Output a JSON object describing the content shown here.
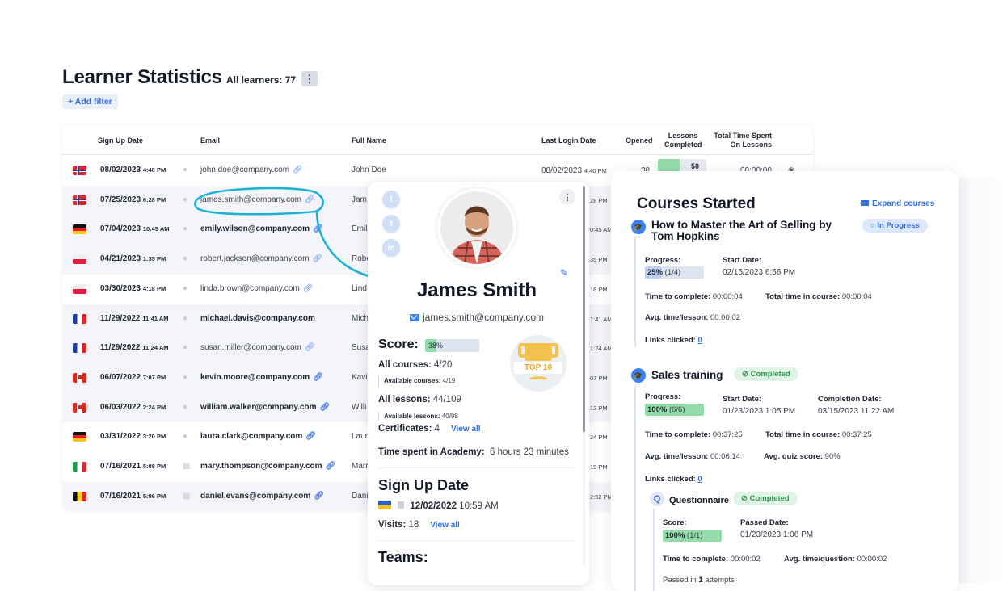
{
  "header": {
    "title": "Learner Statistics",
    "learner_count": "All learners: 77",
    "menu_icon": "kebab-menu-icon",
    "add_filter": "+ Add filter"
  },
  "table": {
    "columns": [
      "Sign Up Date",
      "Email",
      "Full Name",
      "Last Login Date",
      "Opened",
      "Lessons Completed",
      "Total Time Spent On Lessons"
    ],
    "rows": [
      {
        "country": "norway",
        "date": "08/02/2023",
        "time": "4:40 PM",
        "os": "apple",
        "email": "john.doe@company.com",
        "email_bold": false,
        "link": true,
        "name": "John Doe",
        "login_date": "08/02/2023",
        "login_time": "4:40 PM",
        "opened": "38",
        "lessons": "50",
        "lessons_fraction": 0.45,
        "time_spent": "00:00:00"
      },
      {
        "country": "norway",
        "date": "07/25/2023",
        "time": "6:28 PM",
        "os": "apple",
        "email": "james.smith@company.com",
        "email_bold": false,
        "link": true,
        "name": "Jam",
        "login_tail": "28 PM"
      },
      {
        "country": "germany",
        "date": "07/04/2023",
        "time": "10:45 AM",
        "os": "apple",
        "email": "emily.wilson@company.com",
        "email_bold": true,
        "link": true,
        "name": "Emil",
        "login_tail": "0:45 AM"
      },
      {
        "country": "poland",
        "date": "04/21/2023",
        "time": "1:35 PM",
        "os": "apple",
        "email": "robert.jackson@company.com",
        "email_bold": false,
        "link": true,
        "name": "Robe",
        "login_tail": "35 PM"
      },
      {
        "country": "poland",
        "date": "03/30/2023",
        "time": "4:18 PM",
        "os": "apple",
        "email": "linda.brown@company.com",
        "email_bold": false,
        "link": true,
        "name": "Lind",
        "login_tail": "18 PM"
      },
      {
        "country": "france",
        "date": "11/29/2022",
        "time": "11:41 AM",
        "os": "apple",
        "email": "michael.davis@company.com",
        "email_bold": true,
        "link": false,
        "name": "Mich",
        "login_tail": "1:41 AM"
      },
      {
        "country": "france",
        "date": "11/29/2022",
        "time": "11:24 AM",
        "os": "apple",
        "email": "susan.miller@company.com",
        "email_bold": false,
        "link": true,
        "name": "Susa",
        "login_tail": "1:24 AM"
      },
      {
        "country": "canada",
        "date": "06/07/2022",
        "time": "7:07 PM",
        "os": "apple",
        "email": "kevin.moore@company.com",
        "email_bold": true,
        "link": true,
        "name": "Kavi",
        "login_tail": "07 PM"
      },
      {
        "country": "canada",
        "date": "06/03/2022",
        "time": "2:24 PM",
        "os": "apple",
        "email": "william.walker@company.com",
        "email_bold": true,
        "link": true,
        "name": "Willi",
        "login_tail": "13 PM"
      },
      {
        "country": "germany",
        "date": "03/31/2022",
        "time": "3:20 PM",
        "os": "apple",
        "email": "laura.clark@company.com",
        "email_bold": true,
        "link": true,
        "name": "Laur",
        "login_tail": "24 PM"
      },
      {
        "country": "italy",
        "date": "07/16/2021",
        "time": "5:08 PM",
        "os": "windows",
        "email": "mary.thompson@company.com",
        "email_bold": true,
        "link": true,
        "name": "Marr",
        "login_tail": "19 PM"
      },
      {
        "country": "belgium",
        "date": "07/16/2021",
        "time": "5:06 PM",
        "os": "windows",
        "email": "daniel.evans@company.com",
        "email_bold": true,
        "link": true,
        "name": "Dani",
        "login_tail": "2:52 PM"
      }
    ]
  },
  "profile": {
    "social": [
      "f",
      "t",
      "in"
    ],
    "name": "James Smith",
    "email": "james.smith@company.com",
    "score_label": "Score:",
    "score": "38%",
    "score_fraction": 0.38,
    "all_courses_label": "All courses:",
    "all_courses": "4/20",
    "available_courses_label": "Available courses:",
    "available_courses": "4/19",
    "all_lessons_label": "All lessons:",
    "all_lessons": "44/109",
    "available_lessons_label": "Available lessons:",
    "available_lessons": "40/98",
    "certificates_label": "Certificates:",
    "certificates": "4",
    "view_all": "View all",
    "time_label": "Time spent in Academy:",
    "time_value": "6 hours 23 minutes",
    "badge": "TOP 10",
    "signup_heading": "Sign Up Date",
    "signup_date": "12/02/2022",
    "signup_time": "10:59 AM",
    "visits_label": "Visits:",
    "visits": "18",
    "visits_view_all": "View all",
    "teams_heading": "Teams:"
  },
  "courses": {
    "title": "Courses Started",
    "expand": "Expand courses",
    "items": [
      {
        "title_line1": "How to Master the Art of Selling by",
        "title_line2": "Tom Hopkins",
        "status": "In Progress",
        "progress_label": "Progress:",
        "progress_pct": "25%",
        "progress_count": "(1/4)",
        "progress_fraction": 0.25,
        "start_label": "Start Date:",
        "start": "02/15/2023 6:56 PM",
        "ttc_label": "Time to complete:",
        "ttc": "00:00:04",
        "total_label": "Total time in course:",
        "total": "00:00:04",
        "avg_label": "Avg. time/lesson:",
        "avg": "00:00:02",
        "links_label": "Links clicked:",
        "links": "0"
      },
      {
        "title": "Sales training",
        "status": "Completed",
        "progress_label": "Progress:",
        "progress_pct": "100%",
        "progress_count": "(6/6)",
        "progress_fraction": 1.0,
        "start_label": "Start Date:",
        "start": "01/23/2023 1:05 PM",
        "completion_label": "Completion Date:",
        "completion": "03/15/2023 11:22 AM",
        "ttc_label": "Time to complete:",
        "ttc": "00:37:25",
        "total_label": "Total time in course:",
        "total": "00:37:25",
        "avg_label": "Avg. time/lesson:",
        "avg": "00:06:14",
        "quiz_label": "Avg. quiz score:",
        "quiz": "90%",
        "links_label": "Links clicked:",
        "links": "0",
        "quiz_item": {
          "icon": "Q",
          "title": "Questionnaire",
          "status": "Completed",
          "score_label": "Score:",
          "score_pct": "100%",
          "score_count": "(1/1)",
          "score_fraction": 1.0,
          "passed_label": "Passed Date:",
          "passed": "01/23/2023 1:06 PM",
          "ttc_label": "Time to complete:",
          "ttc": "00:00:02",
          "avgq_label": "Avg. time/question:",
          "avgq": "00:00:02",
          "attempts_prefix": "Passed in",
          "attempts": "1",
          "attempts_suffix": "attempts"
        }
      }
    ]
  },
  "colors": {
    "accent": "#2f6fe4",
    "success": "#93dcaa",
    "annotation": "#19b1d6"
  }
}
